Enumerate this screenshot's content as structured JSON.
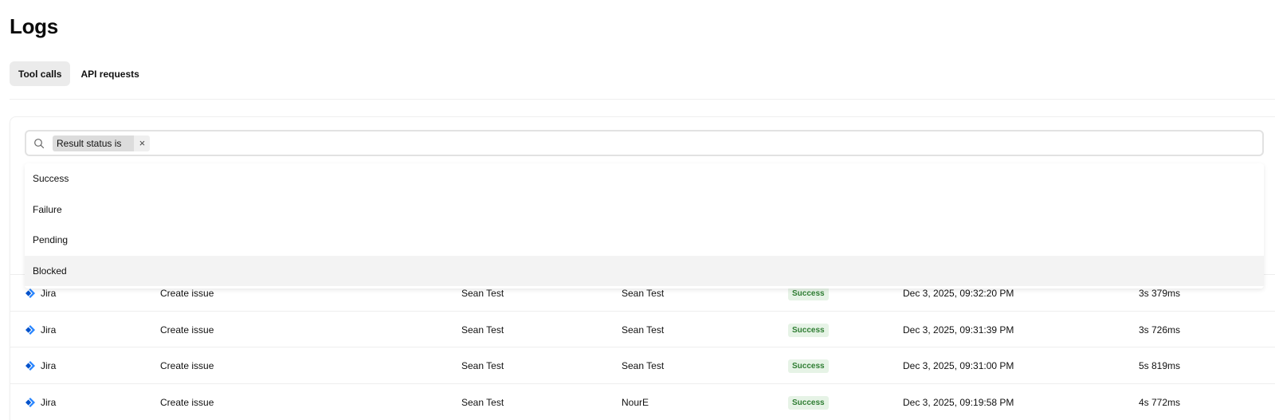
{
  "page": {
    "title": "Logs"
  },
  "tabs": [
    {
      "label": "Tool calls",
      "active": true
    },
    {
      "label": "API requests",
      "active": false
    }
  ],
  "filter": {
    "chip_label": "Result status is",
    "chip_close": "×",
    "input_value": "",
    "placeholder": ""
  },
  "dropdown": {
    "options": [
      "Success",
      "Failure",
      "Pending",
      "Blocked"
    ],
    "highlighted": "Blocked"
  },
  "table": {
    "rows": [
      {
        "source": "Jira",
        "action": "Create issue",
        "user": "Sean Test",
        "actor": "Sean Test",
        "status": "Success",
        "timestamp": "Dec 3, 2025, 09:32:20 PM",
        "duration": "3s 379ms"
      },
      {
        "source": "Jira",
        "action": "Create issue",
        "user": "Sean Test",
        "actor": "Sean Test",
        "status": "Success",
        "timestamp": "Dec 3, 2025, 09:31:39 PM",
        "duration": "3s 726ms"
      },
      {
        "source": "Jira",
        "action": "Create issue",
        "user": "Sean Test",
        "actor": "Sean Test",
        "status": "Success",
        "timestamp": "Dec 3, 2025, 09:31:00 PM",
        "duration": "5s 819ms"
      },
      {
        "source": "Jira",
        "action": "Create issue",
        "user": "Sean Test",
        "actor": "NourE",
        "status": "Success",
        "timestamp": "Dec 3, 2025, 09:19:58 PM",
        "duration": "4s 772ms"
      }
    ]
  },
  "colors": {
    "success_badge_bg": "#e6f3e6",
    "success_badge_text": "#2e7d32",
    "jira_blue": "#2684ff",
    "active_tab_bg": "#ebebeb"
  }
}
